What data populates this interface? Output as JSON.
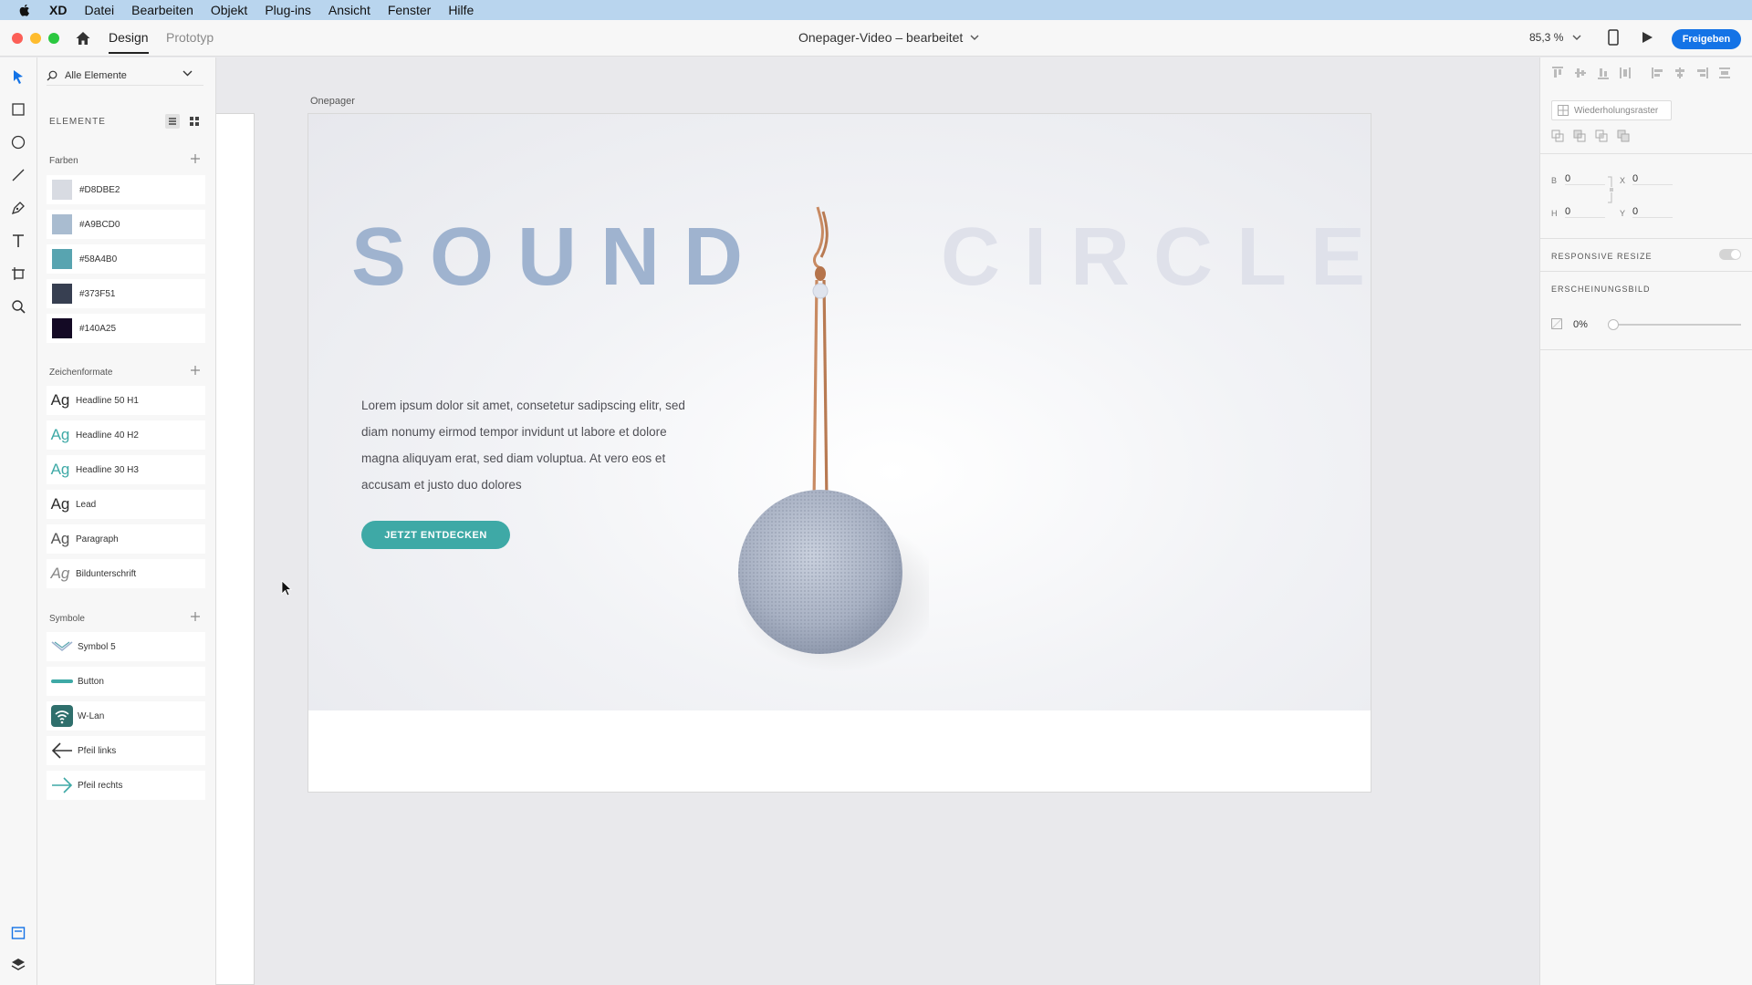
{
  "menubar": {
    "app": "XD",
    "items": [
      "Datei",
      "Bearbeiten",
      "Objekt",
      "Plug-ins",
      "Ansicht",
      "Fenster",
      "Hilfe"
    ]
  },
  "topbar": {
    "tabs": [
      "Design",
      "Prototyp"
    ],
    "doc_title": "Onepager-Video – bearbeitet",
    "zoom": "85,3 %",
    "share_label": "Freigeben"
  },
  "assets": {
    "search_placeholder": "Alle Elemente",
    "heading": "ELEMENTE",
    "colors_title": "Farben",
    "colors": [
      {
        "label": "#D8DBE2",
        "hex": "#D8DBE2"
      },
      {
        "label": "#A9BCD0",
        "hex": "#A9BCD0"
      },
      {
        "label": "#58A4B0",
        "hex": "#58A4B0"
      },
      {
        "label": "#373F51",
        "hex": "#373F51"
      },
      {
        "label": "#140A25",
        "hex": "#140A25"
      }
    ],
    "charstyles_title": "Zeichenformate",
    "charstyles": [
      {
        "sample": "Ag",
        "label": "Headline 50 H1",
        "color": "#2c2c2c"
      },
      {
        "sample": "Ag",
        "label": "Headline 40 H2",
        "color": "#3ea9a6"
      },
      {
        "sample": "Ag",
        "label": "Headline 30 H3",
        "color": "#3ea9a6"
      },
      {
        "sample": "Ag",
        "label": "Lead",
        "color": "#2c2c2c"
      },
      {
        "sample": "Ag",
        "label": "Paragraph",
        "color": "#555555"
      },
      {
        "sample": "Ag",
        "label": "Bildunterschrift",
        "color": "#888888"
      }
    ],
    "symbols_title": "Symbole",
    "symbols": [
      {
        "label": "Symbol 5",
        "icon": "chevron-symbol-icon"
      },
      {
        "label": "Button",
        "icon": "button-symbol-icon"
      },
      {
        "label": "W-Lan",
        "icon": "wifi-icon"
      },
      {
        "label": "Pfeil links",
        "icon": "arrow-left-icon"
      },
      {
        "label": "Pfeil rechts",
        "icon": "arrow-right-icon"
      }
    ]
  },
  "canvas": {
    "artboard_label": "Onepager",
    "headline_left": "SOUND",
    "headline_right": "CIRCLE",
    "lead_text": "Lorem ipsum dolor sit amet, consetetur sadipscing elitr, sed diam nonumy eirmod tempor invidunt ut labore et dolore magna aliquyam erat, sed diam voluptua. At vero eos et accusam et justo duo dolores",
    "cta_label": "JETZT ENTDECKEN",
    "accent": "#3ea9a6"
  },
  "inspector": {
    "repeat_grid_label": "Wiederholungsraster",
    "w_label": "B",
    "w_value": "0",
    "x_label": "X",
    "x_value": "0",
    "h_label": "H",
    "h_value": "0",
    "y_label": "Y",
    "y_value": "0",
    "responsive_label": "RESPONSIVE RESIZE",
    "appearance_label": "ERSCHEINUNGSBILD",
    "opacity": "0%",
    "opacity_fraction": 0
  }
}
